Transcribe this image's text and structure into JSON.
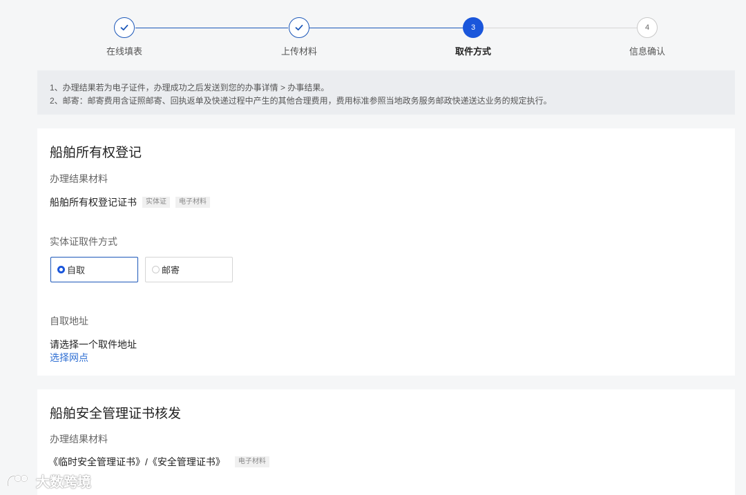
{
  "steps": [
    {
      "label": "在线填表",
      "state": "done"
    },
    {
      "label": "上传材料",
      "state": "done"
    },
    {
      "label": "取件方式",
      "state": "current",
      "number": "3"
    },
    {
      "label": "信息确认",
      "state": "pending",
      "number": "4"
    }
  ],
  "notice": {
    "line1": "1、办理结果若为电子证件，办理成功之后发送到您的办事详情 > 办事结果。",
    "line2": "2、邮寄：邮寄费用含证照邮寄、回执返单及快递过程中产生的其他合理费用，费用标准参照当地政务服务邮政快递送达业务的规定执行。"
  },
  "card1": {
    "title": "船舶所有权登记",
    "materials_label": "办理结果材料",
    "material_name": "船舶所有权登记证书",
    "tags": [
      "实体证",
      "电子材料"
    ],
    "pickup_label": "实体证取件方式",
    "options": [
      {
        "label": "自取",
        "selected": true
      },
      {
        "label": "邮寄",
        "selected": false
      }
    ],
    "address_label": "自取地址",
    "address_prompt": "请选择一个取件地址",
    "choose_link": "选择网点"
  },
  "card2": {
    "title": "船舶安全管理证书核发",
    "materials_label": "办理结果材料",
    "material_name": "《临时安全管理证书》/《安全管理证书》",
    "tags": [
      "电子材料"
    ]
  },
  "watermark": {
    "text": "大数跨境"
  },
  "colors": {
    "primary": "#1a56db",
    "link": "#2f6fd3"
  }
}
